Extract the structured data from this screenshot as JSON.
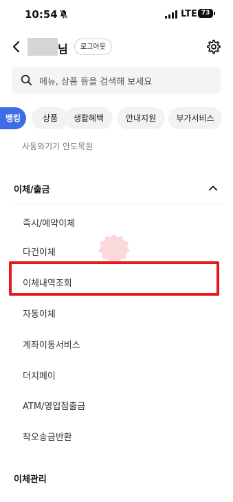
{
  "status_bar": {
    "time": "10:54",
    "network": "LTE",
    "battery": "73"
  },
  "header": {
    "user_suffix": "님",
    "logout_label": "로그아웃"
  },
  "search": {
    "placeholder": "메뉴, 상품 등을 검색해 보세요"
  },
  "chips": [
    {
      "label": "뱅킹",
      "active": true
    },
    {
      "label": "상품",
      "active": false
    },
    {
      "label": "생활혜택",
      "active": false
    },
    {
      "label": "안내지원",
      "active": false
    },
    {
      "label": "부가서비스",
      "active": false
    }
  ],
  "partial_row_label": "사동와기기 안도목원",
  "transfer_section": {
    "title": "이체/출금",
    "items": [
      "즉시/예약이체",
      "다건이체",
      "이체내역조회",
      "자동이체",
      "계좌이동서비스",
      "더치페이",
      "ATM/영업점출금",
      "착오송금반환"
    ]
  },
  "transfer_manage_section": {
    "title": "이체관리"
  },
  "colors": {
    "accent": "#3d6de7",
    "highlight": "#e8171b",
    "chip_bg": "#f1f2f4",
    "search_bg": "#f3f4f6"
  },
  "icons": {
    "back": "chevron-left-icon",
    "settings": "gear-icon",
    "search": "search-icon",
    "collapse": "chevron-up-icon",
    "silent": "bell-off-icon",
    "signal": "signal-icon"
  }
}
